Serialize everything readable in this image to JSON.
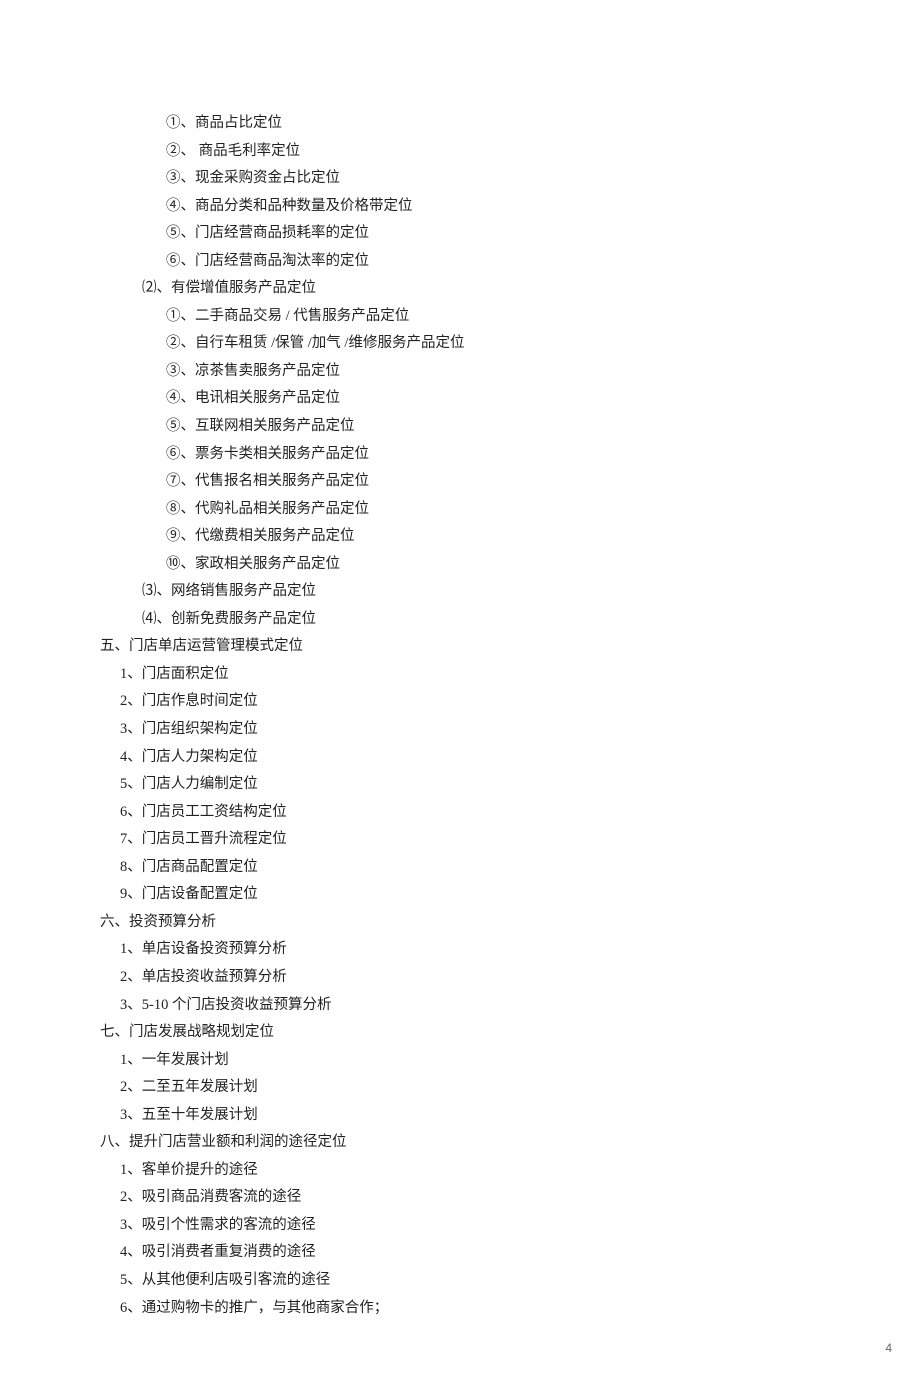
{
  "lines": [
    {
      "indent": 3,
      "text": "①、商品占比定位"
    },
    {
      "indent": 3,
      "text": "②、 商品毛利率定位"
    },
    {
      "indent": 3,
      "text": "③、现金采购资金占比定位"
    },
    {
      "indent": 3,
      "text": "④、商品分类和品种数量及价格带定位"
    },
    {
      "indent": 3,
      "text": "⑤、门店经营商品损耗率的定位"
    },
    {
      "indent": 3,
      "text": "⑥、门店经营商品淘汰率的定位"
    },
    {
      "indent": 2,
      "text": "⑵、有偿增值服务产品定位"
    },
    {
      "indent": 3,
      "text": "①、二手商品交易  / 代售服务产品定位"
    },
    {
      "indent": 3,
      "text": "②、自行车租赁  /保管 /加气 /维修服务产品定位"
    },
    {
      "indent": 3,
      "text": "③、凉茶售卖服务产品定位"
    },
    {
      "indent": 3,
      "text": "④、电讯相关服务产品定位"
    },
    {
      "indent": 3,
      "text": "⑤、互联网相关服务产品定位"
    },
    {
      "indent": 3,
      "text": "⑥、票务卡类相关服务产品定位"
    },
    {
      "indent": 3,
      "text": "⑦、代售报名相关服务产品定位"
    },
    {
      "indent": 3,
      "text": "⑧、代购礼品相关服务产品定位"
    },
    {
      "indent": 3,
      "text": "⑨、代缴费相关服务产品定位"
    },
    {
      "indent": 3,
      "text": "⑩、家政相关服务产品定位"
    },
    {
      "indent": 2,
      "text": "⑶、网络销售服务产品定位"
    },
    {
      "indent": 2,
      "text": "⑷、创新免费服务产品定位"
    },
    {
      "indent": 0,
      "text": "五、门店单店运营管理模式定位"
    },
    {
      "indent": 1,
      "text": "1、门店面积定位"
    },
    {
      "indent": 1,
      "text": "2、门店作息时间定位"
    },
    {
      "indent": 1,
      "text": "3、门店组织架构定位"
    },
    {
      "indent": 1,
      "text": "4、门店人力架构定位"
    },
    {
      "indent": 1,
      "text": "5、门店人力编制定位"
    },
    {
      "indent": 1,
      "text": "6、门店员工工资结构定位"
    },
    {
      "indent": 1,
      "text": "7、门店员工晋升流程定位"
    },
    {
      "indent": 1,
      "text": "8、门店商品配置定位"
    },
    {
      "indent": 1,
      "text": "9、门店设备配置定位"
    },
    {
      "indent": 0,
      "text": "六、投资预算分析"
    },
    {
      "indent": 1,
      "text": "1、单店设备投资预算分析"
    },
    {
      "indent": 1,
      "text": "2、单店投资收益预算分析"
    },
    {
      "indent": 1,
      "text": "3、5-10 个门店投资收益预算分析"
    },
    {
      "indent": 0,
      "text": "七、门店发展战略规划定位"
    },
    {
      "indent": 1,
      "text": "1、一年发展计划"
    },
    {
      "indent": 1,
      "text": "2、二至五年发展计划"
    },
    {
      "indent": 1,
      "text": "3、五至十年发展计划"
    },
    {
      "indent": 0,
      "text": "八、提升门店营业额和利润的途径定位"
    },
    {
      "indent": 1,
      "text": "1、客单价提升的途径"
    },
    {
      "indent": 1,
      "text": "2、吸引商品消费客流的途径"
    },
    {
      "indent": 1,
      "text": "3、吸引个性需求的客流的途径"
    },
    {
      "indent": 1,
      "text": "4、吸引消费者重复消费的途径"
    },
    {
      "indent": 1,
      "text": "5、从其他便利店吸引客流的途径"
    },
    {
      "indent": 1,
      "text": "6、通过购物卡的推广，与其他商家合作；"
    }
  ],
  "page_number": "4"
}
